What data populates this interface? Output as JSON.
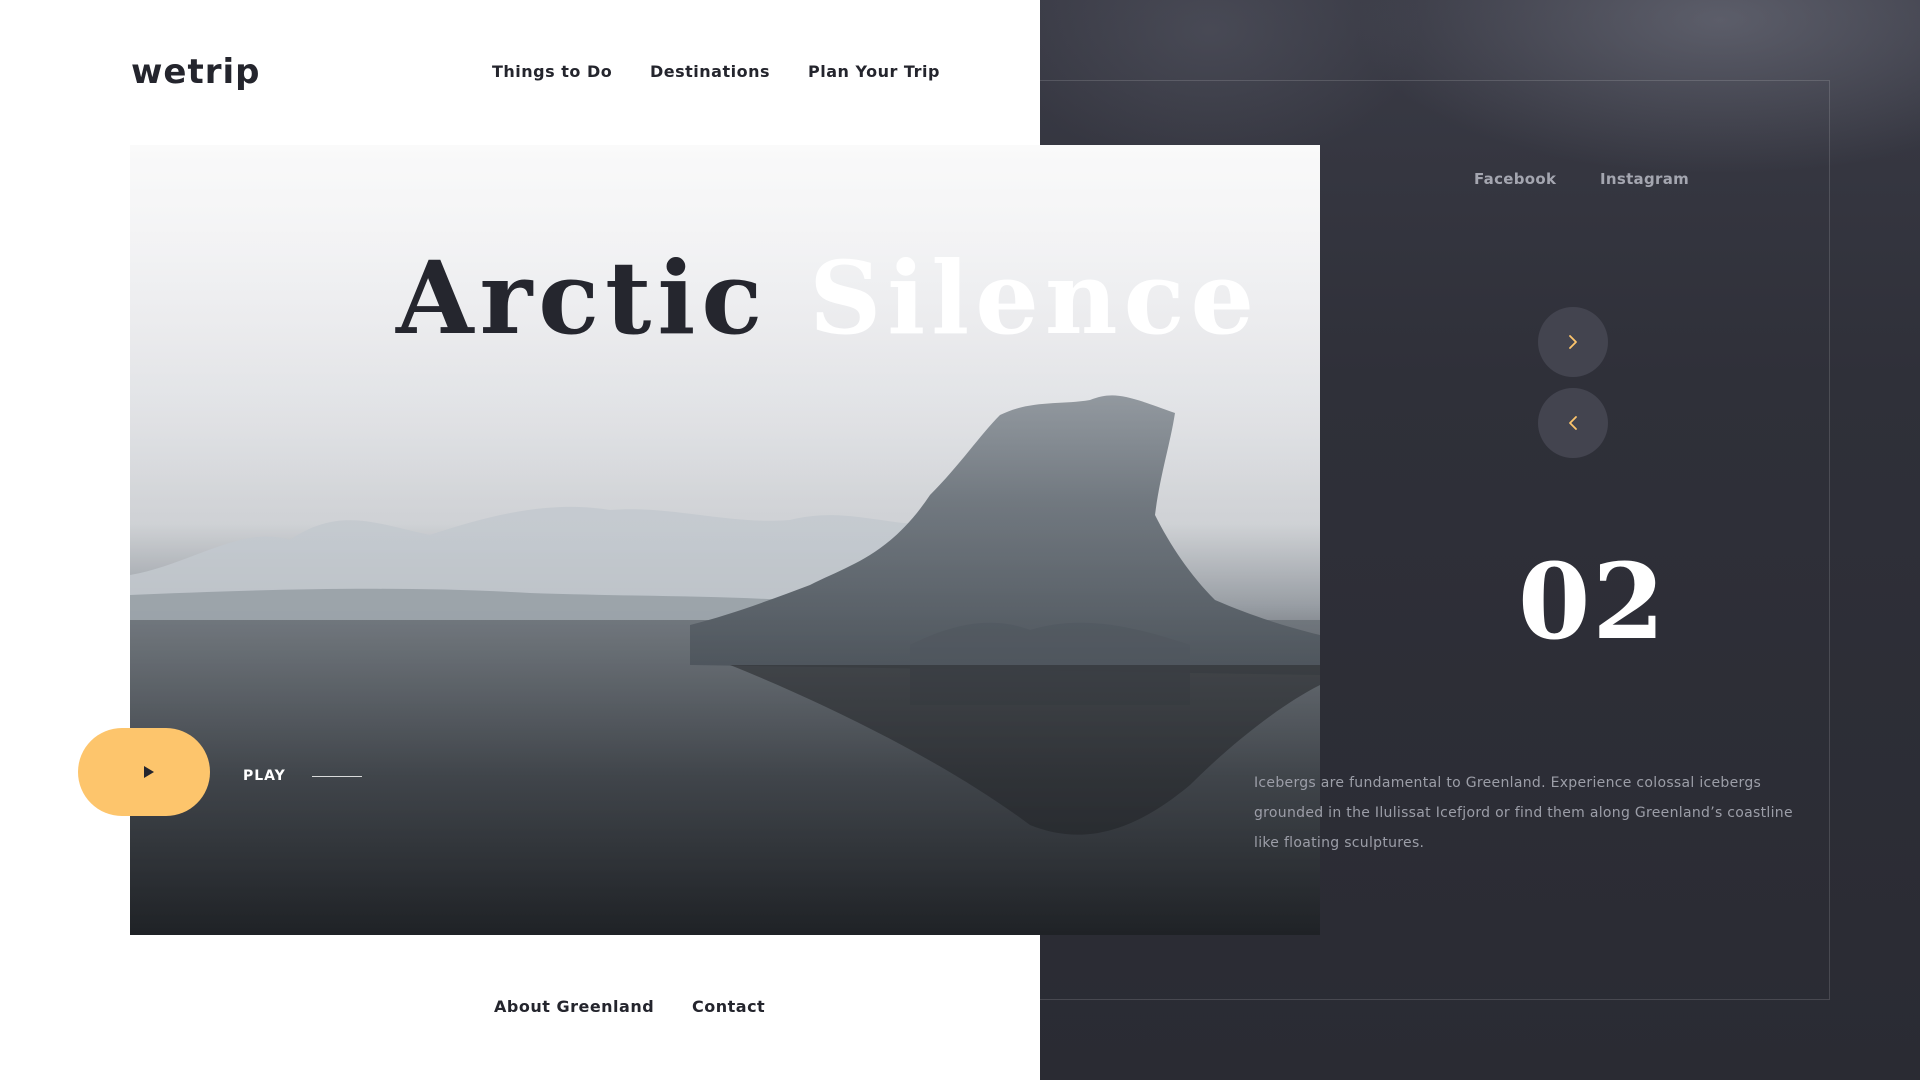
{
  "brand": {
    "logo": "wetrip"
  },
  "nav": {
    "items": [
      "Things to Do",
      "Destinations",
      "Plan Your Trip"
    ]
  },
  "social": {
    "items": [
      "Facebook",
      "Instagram"
    ]
  },
  "hero": {
    "title_part1": "Arctic",
    "title_part2": "Silence",
    "play_label": "PLAY"
  },
  "slider": {
    "next_icon": "chevron-right-icon",
    "prev_icon": "chevron-left-icon",
    "current": "02",
    "description": "Icebergs are fundamental to Greenland. Experience colossal icebergs grounded in the Ilulissat Icefjord or find them along Greenland’s coastline like floating sculptures."
  },
  "footer": {
    "items": [
      "About Greenland",
      "Contact"
    ]
  },
  "colors": {
    "accent": "#fdc56c",
    "dark_panel": "#2e2f38",
    "text_dark": "#24252d"
  }
}
